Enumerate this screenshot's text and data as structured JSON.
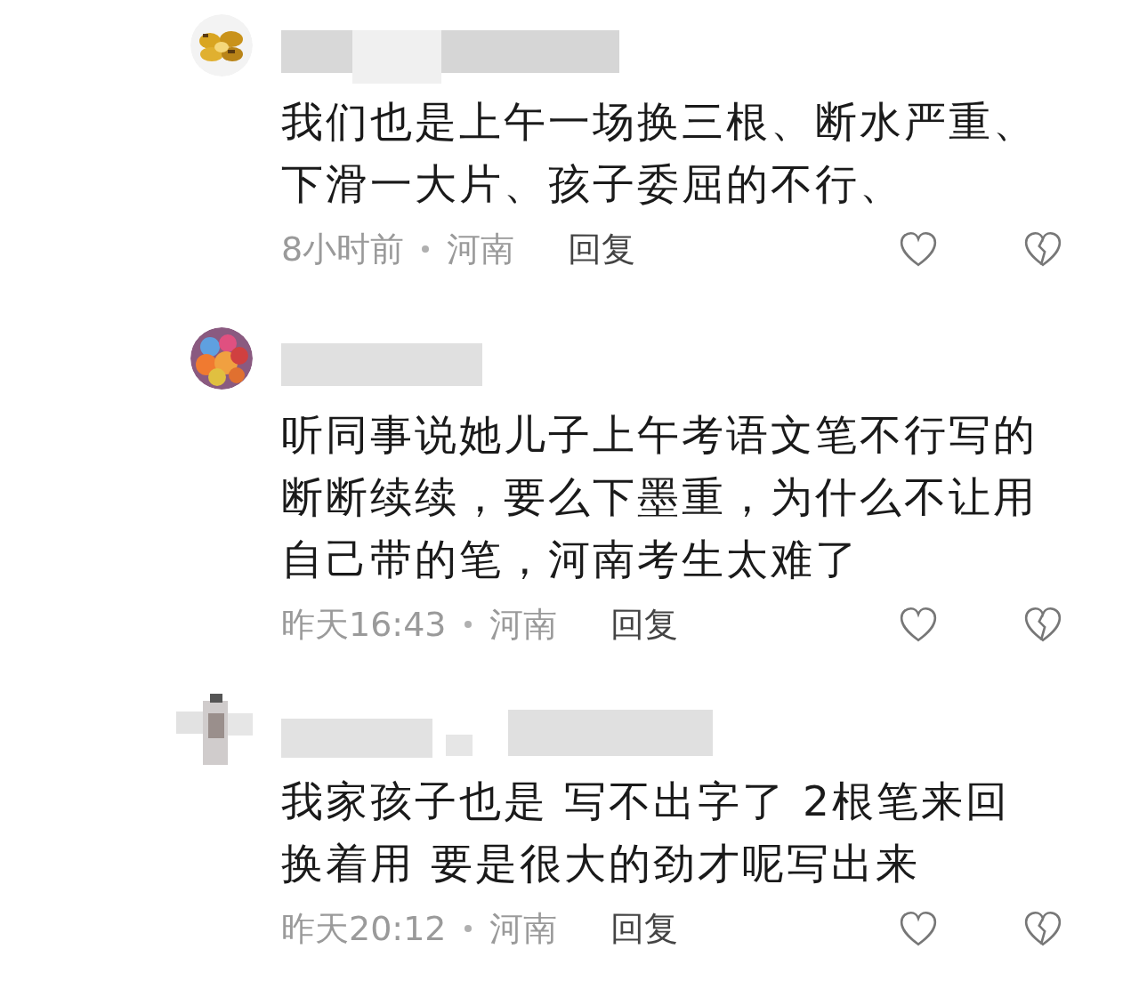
{
  "comments": [
    {
      "lines": [
        "我们也是上午一场换三根、断水严重、",
        "下滑一大片、孩子委屈的不行、"
      ],
      "time": "8小时前",
      "location": "河南",
      "reply": "回复"
    },
    {
      "lines": [
        "听同事说她儿子上午考语文笔不行写的",
        "断断续续，要么下墨重，为什么不让用",
        "自己带的笔，河南考生太难了"
      ],
      "time": "昨天16:43",
      "location": "河南",
      "reply": "回复"
    },
    {
      "lines": [
        "我家孩子也是 写不出字了 2根笔来回",
        "换着用 要是很大的劲才呢写出来"
      ],
      "time": "昨天20:12",
      "location": "河南",
      "reply": "回复"
    }
  ]
}
